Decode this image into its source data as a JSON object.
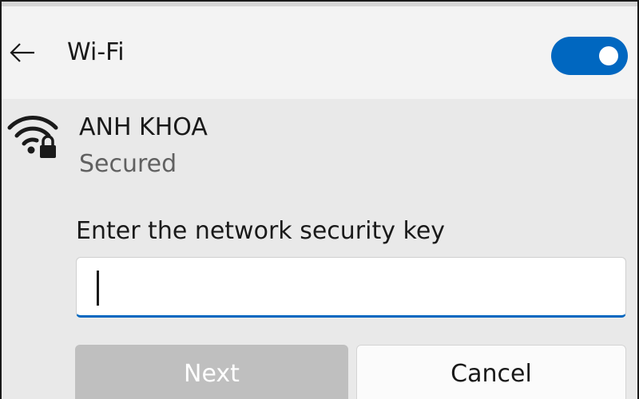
{
  "header": {
    "title": "Wi-Fi",
    "wifi_enabled": true,
    "accent_color": "#0067c0"
  },
  "network": {
    "ssid": "ANH KHOA",
    "status": "Secured",
    "icon": "wifi-secured-icon"
  },
  "security_key": {
    "label": "Enter the network security key",
    "value": ""
  },
  "buttons": {
    "next_label": "Next",
    "next_enabled": false,
    "cancel_label": "Cancel"
  }
}
